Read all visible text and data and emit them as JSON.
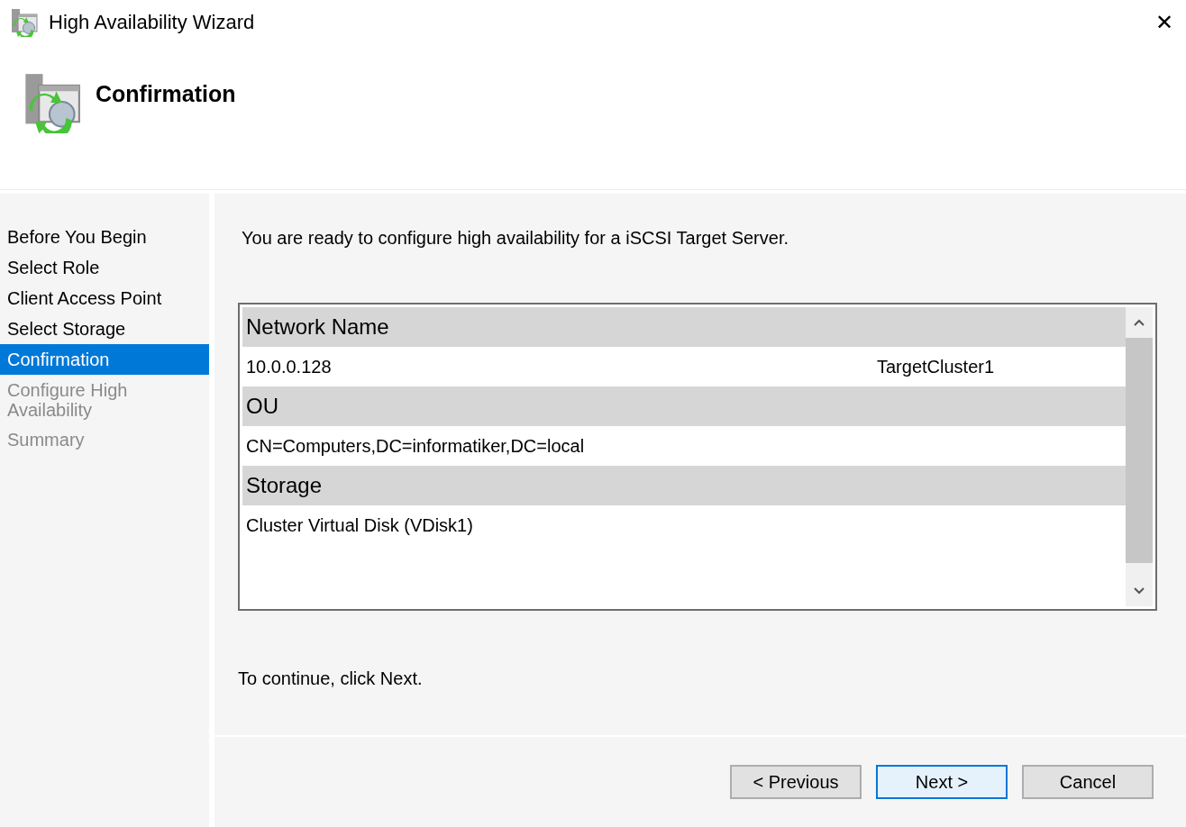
{
  "window": {
    "title": "High Availability Wizard",
    "close": "✕"
  },
  "header": {
    "title": "Confirmation"
  },
  "steps": [
    {
      "label": "Before You Begin",
      "selected": false,
      "disabled": false
    },
    {
      "label": "Select Role",
      "selected": false,
      "disabled": false
    },
    {
      "label": "Client Access Point",
      "selected": false,
      "disabled": false
    },
    {
      "label": "Select Storage",
      "selected": false,
      "disabled": false
    },
    {
      "label": "Confirmation",
      "selected": true,
      "disabled": false
    },
    {
      "label": "Configure High Availability",
      "selected": false,
      "disabled": true
    },
    {
      "label": "Summary",
      "selected": false,
      "disabled": true
    }
  ],
  "intro": "You are ready to configure high availability for a iSCSI Target Server.",
  "report": {
    "sections": [
      {
        "heading": "Network Name",
        "rows": [
          [
            "10.0.0.128",
            "TargetCluster1"
          ]
        ]
      },
      {
        "heading": "OU",
        "rows": [
          [
            "CN=Computers,DC=informatiker,DC=local"
          ]
        ]
      },
      {
        "heading": "Storage",
        "rows": [
          [
            "Cluster Virtual Disk (VDisk1)"
          ]
        ]
      }
    ]
  },
  "footer_text": "To continue, click Next.",
  "buttons": [
    {
      "label": "< Previous",
      "focused": false
    },
    {
      "label": "Next >",
      "focused": true
    },
    {
      "label": "Cancel",
      "focused": false
    }
  ]
}
